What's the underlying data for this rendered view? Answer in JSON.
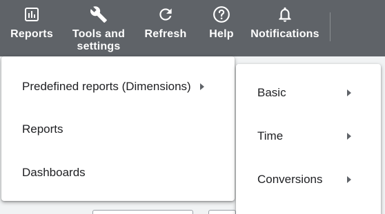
{
  "toolbar": {
    "items": [
      {
        "label": "Reports",
        "icon": "bar-chart-icon"
      },
      {
        "label": "Tools and\nsettings",
        "icon": "wrench-icon"
      },
      {
        "label": "Refresh",
        "icon": "refresh-icon"
      },
      {
        "label": "Help",
        "icon": "help-circle-icon"
      },
      {
        "label": "Notifications",
        "icon": "bell-icon"
      }
    ],
    "background": "#5f6368"
  },
  "reports_menu": {
    "items": [
      {
        "label": "Predefined reports (Dimensions)",
        "has_submenu": true
      },
      {
        "label": "Reports",
        "has_submenu": false
      },
      {
        "label": "Dashboards",
        "has_submenu": false
      }
    ]
  },
  "predefined_submenu": {
    "items": [
      {
        "label": "Basic",
        "has_submenu": true
      },
      {
        "label": "Time",
        "has_submenu": true
      },
      {
        "label": "Conversions",
        "has_submenu": true
      }
    ]
  }
}
